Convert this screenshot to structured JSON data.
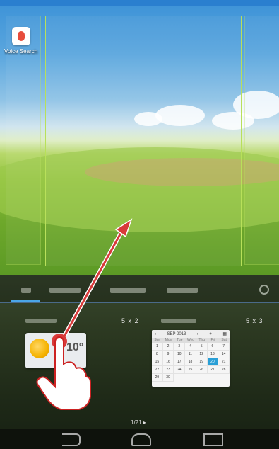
{
  "home": {
    "app_label": "Voice Search"
  },
  "widget_tray": {
    "size_a": "5 x 2",
    "size_b": "5 x 3",
    "weather_temp": "10°",
    "calendar": {
      "month": "SEP 2013",
      "days": [
        "Sun",
        "Mon",
        "Tue",
        "Wed",
        "Thu",
        "Fri",
        "Sat"
      ],
      "dates": [
        "1",
        "2",
        "3",
        "4",
        "5",
        "6",
        "7",
        "8",
        "9",
        "10",
        "11",
        "12",
        "13",
        "14",
        "15",
        "16",
        "17",
        "18",
        "19",
        "20",
        "21",
        "22",
        "23",
        "24",
        "25",
        "26",
        "27",
        "28",
        "29",
        "30"
      ]
    },
    "page": "1/21 ▸"
  },
  "colors": {
    "status_bar": "#2a7fcf",
    "frame": "#b8e05a",
    "arrow": "#d83a3a",
    "tab_accent": "#4aa6e8"
  }
}
